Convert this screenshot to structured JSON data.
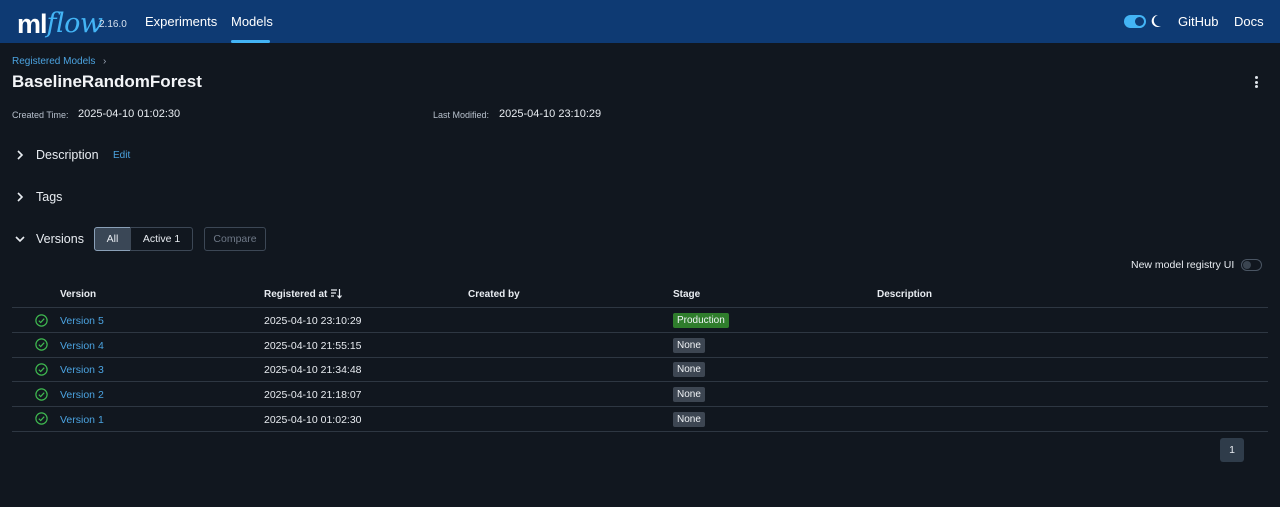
{
  "app": {
    "logo_ml": "ml",
    "logo_flow": "flow",
    "version": "2.16.0",
    "nav": {
      "experiments": "Experiments",
      "models": "Models",
      "github": "GitHub",
      "docs": "Docs"
    },
    "accent_color": "#43b4f5",
    "navbar_color": "#0e3a73"
  },
  "page": {
    "breadcrumb": "Registered Models",
    "breadcrumb_sep": "›",
    "title": "BaselineRandomForest",
    "created_label": "Created Time:",
    "created_value": "2025-04-10 01:02:30",
    "modified_label": "Last Modified:",
    "modified_value": "2025-04-10 23:10:29"
  },
  "sections": {
    "description": "Description",
    "edit": "Edit",
    "tags": "Tags",
    "versions": "Versions"
  },
  "versions_toolbar": {
    "all": "All",
    "active": "Active 1",
    "compare": "Compare",
    "registry_toggle_label": "New model registry UI"
  },
  "table": {
    "headers": {
      "version": "Version",
      "registered": "Registered at",
      "created_by": "Created by",
      "stage": "Stage",
      "description": "Description"
    },
    "rows": [
      {
        "version": "Version 5",
        "registered": "2025-04-10 23:10:29",
        "created_by": "",
        "stage": "Production",
        "description": ""
      },
      {
        "version": "Version 4",
        "registered": "2025-04-10 21:55:15",
        "created_by": "",
        "stage": "None",
        "description": ""
      },
      {
        "version": "Version 3",
        "registered": "2025-04-10 21:34:48",
        "created_by": "",
        "stage": "None",
        "description": ""
      },
      {
        "version": "Version 2",
        "registered": "2025-04-10 21:18:07",
        "created_by": "",
        "stage": "None",
        "description": ""
      },
      {
        "version": "Version 1",
        "registered": "2025-04-10 01:02:30",
        "created_by": "",
        "stage": "None",
        "description": ""
      }
    ]
  },
  "pagination": {
    "current": "1"
  },
  "icons": {
    "theme": "moon-icon",
    "menu": "kebab-menu-icon",
    "sort": "sort-descending-icon",
    "status": "check-circle-icon"
  }
}
